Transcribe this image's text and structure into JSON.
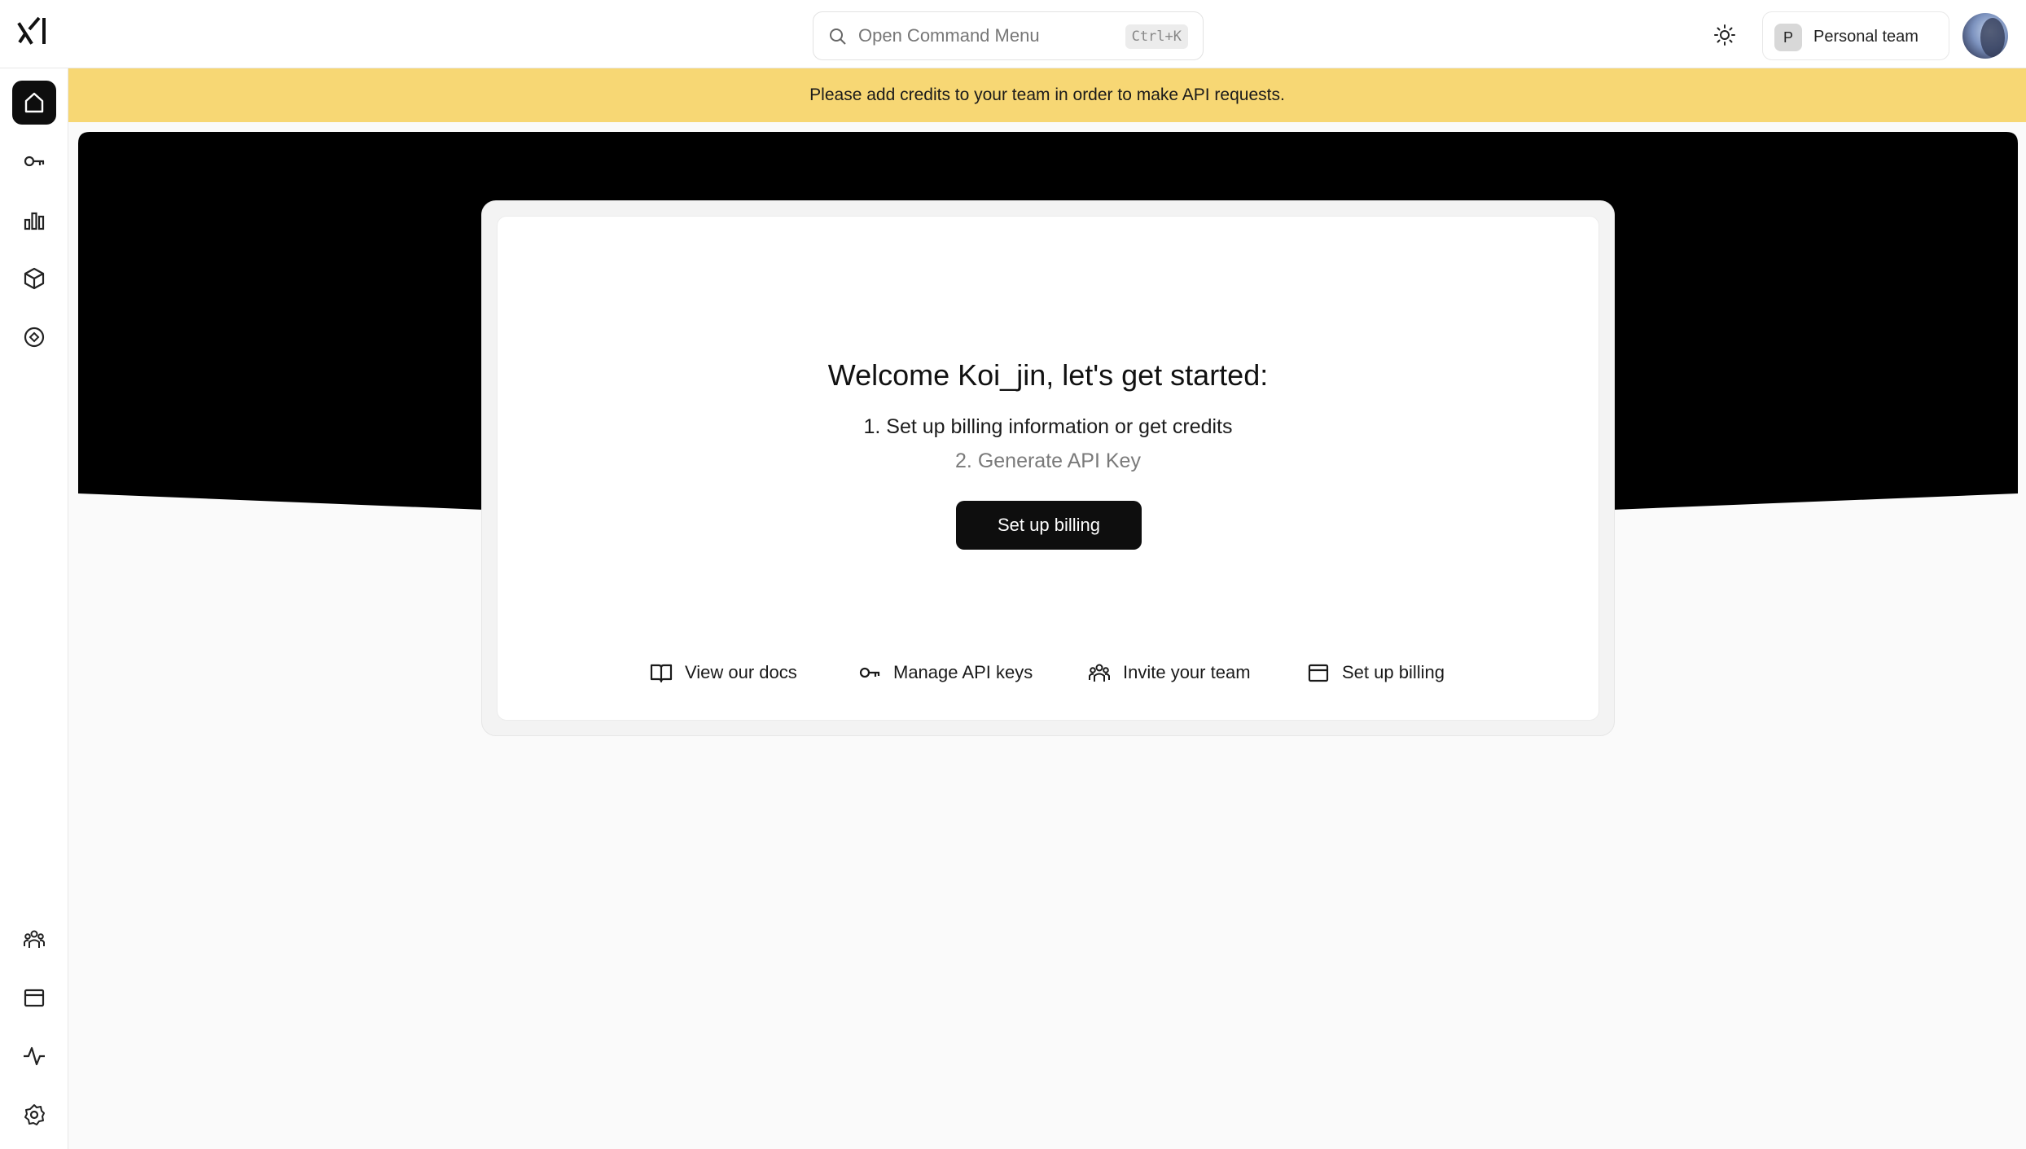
{
  "header": {
    "command_menu": {
      "placeholder": "Open Command Menu",
      "shortcut": "Ctrl+K"
    },
    "team": {
      "initial": "P",
      "name": "Personal team"
    },
    "icons": {
      "logo": "xai-logo-icon",
      "search": "search-icon",
      "theme": "sun-icon",
      "avatar": "avatar"
    }
  },
  "sidebar": {
    "items": [
      {
        "icon": "home-icon",
        "active": true
      },
      {
        "icon": "key-icon",
        "active": false
      },
      {
        "icon": "bar-chart-icon",
        "active": false
      },
      {
        "icon": "cube-icon",
        "active": false
      },
      {
        "icon": "compass-icon",
        "active": false
      },
      {
        "icon": "team-icon",
        "active": false
      },
      {
        "icon": "billing-icon",
        "active": false
      },
      {
        "icon": "activity-icon",
        "active": false
      },
      {
        "icon": "settings-icon",
        "active": false
      }
    ]
  },
  "banner": {
    "text": "Please add credits to your team in order to make API requests."
  },
  "welcome": {
    "title": "Welcome Koi_jin, let's get started:",
    "steps": [
      "1. Set up billing information or get credits",
      "2. Generate API Key"
    ],
    "cta_label": "Set up billing"
  },
  "quick_links": [
    {
      "icon": "book-icon",
      "label": "View our docs"
    },
    {
      "icon": "key-icon",
      "label": "Manage API keys"
    },
    {
      "icon": "team-icon",
      "label": "Invite your team"
    },
    {
      "icon": "billing-icon",
      "label": "Set up billing"
    }
  ],
  "colors": {
    "banner": "#f7d774",
    "primary": "#0e0e0e",
    "background": "#fafafa"
  }
}
